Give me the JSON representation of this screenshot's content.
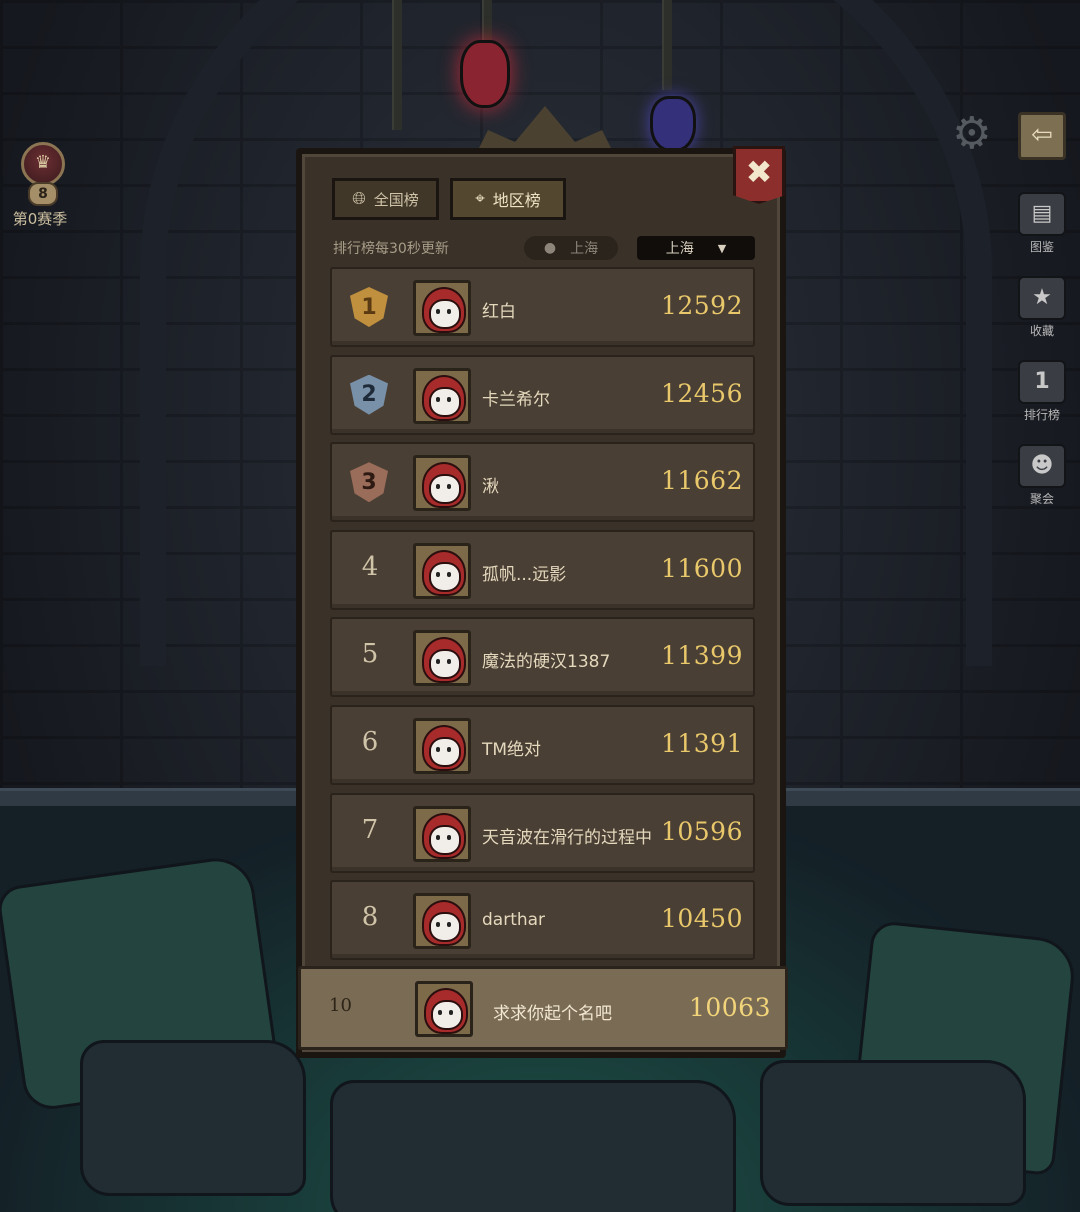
{
  "season": {
    "level": "8",
    "label": "第0赛季",
    "icon": "season-crest-icon"
  },
  "toolbar": {
    "settings_icon": "gear-icon",
    "back_icon": "back-arrow-icon",
    "items": [
      {
        "label": "图鉴",
        "icon": "books-icon"
      },
      {
        "label": "收藏",
        "icon": "star-book-icon"
      },
      {
        "label": "排行榜",
        "icon": "rank-1-icon",
        "glyph": "1"
      },
      {
        "label": "聚会",
        "icon": "party-icon"
      }
    ]
  },
  "leaderboard": {
    "close_icon": "close-icon",
    "tabs": [
      {
        "label": "全国榜",
        "icon": "globe-icon",
        "active": false
      },
      {
        "label": "地区榜",
        "icon": "location-pin-icon",
        "active": true
      }
    ],
    "refresh_note": "排行榜每30秒更新",
    "current_location": "上海",
    "city_select": {
      "value": "上海",
      "icon": "chevron-down-icon"
    },
    "entries": [
      {
        "rank": "1",
        "name": "红白",
        "score": "12592"
      },
      {
        "rank": "2",
        "name": "卡兰希尔",
        "score": "12456"
      },
      {
        "rank": "3",
        "name": "湫",
        "score": "11662"
      },
      {
        "rank": "4",
        "name": "孤帆...远影",
        "score": "11600"
      },
      {
        "rank": "5",
        "name": "魔法的硬汉1387",
        "score": "11399"
      },
      {
        "rank": "6",
        "name": "TM绝对",
        "score": "11391"
      },
      {
        "rank": "7",
        "name": "天音波在滑行的过程中",
        "score": "10596"
      },
      {
        "rank": "8",
        "name": "darthar",
        "score": "10450"
      }
    ],
    "me": {
      "rank": "10",
      "name": "求求你起个名吧",
      "score": "10063"
    }
  },
  "colors": {
    "score": "#e9c86b",
    "panel": "#3a3128",
    "row": "#4a3f34",
    "close": "#8c2e2b"
  }
}
